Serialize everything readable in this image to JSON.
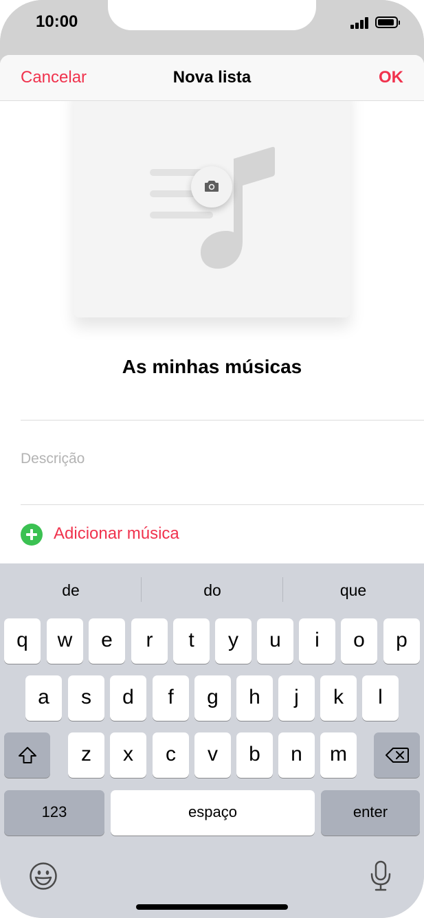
{
  "status_bar": {
    "time": "10:00"
  },
  "nav": {
    "cancel_label": "Cancelar",
    "title": "Nova lista",
    "ok_label": "OK"
  },
  "playlist": {
    "name": "As minhas músicas",
    "description_placeholder": "Descrição",
    "add_music_label": "Adicionar música"
  },
  "keyboard": {
    "suggestions": [
      "de",
      "do",
      "que"
    ],
    "row1": [
      "q",
      "w",
      "e",
      "r",
      "t",
      "y",
      "u",
      "i",
      "o",
      "p"
    ],
    "row2": [
      "a",
      "s",
      "d",
      "f",
      "g",
      "h",
      "j",
      "k",
      "l"
    ],
    "row3": [
      "z",
      "x",
      "c",
      "v",
      "b",
      "n",
      "m"
    ],
    "numbers_label": "123",
    "space_label": "espaço",
    "enter_label": "enter"
  },
  "colors": {
    "accent": "#f0324d",
    "add_green": "#3bc152",
    "keyboard_bg": "#d1d4db"
  },
  "icons": [
    "camera-icon",
    "music-note-icon",
    "shift-icon",
    "delete-icon",
    "emoji-icon",
    "microphone-icon",
    "add-icon"
  ]
}
